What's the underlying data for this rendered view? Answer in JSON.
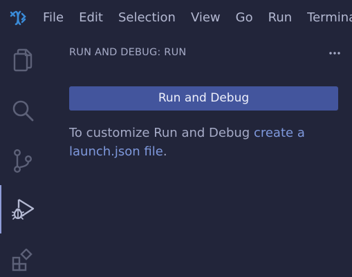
{
  "menubar": {
    "logo_icon": "app-logo-icon",
    "items": [
      "File",
      "Edit",
      "Selection",
      "View",
      "Go",
      "Run",
      "Terminal"
    ]
  },
  "activitybar": {
    "items": [
      {
        "name": "explorer",
        "icon": "files-icon",
        "active": false
      },
      {
        "name": "search",
        "icon": "search-icon",
        "active": false
      },
      {
        "name": "source-control",
        "icon": "source-control-icon",
        "active": false
      },
      {
        "name": "run-and-debug",
        "icon": "run-debug-icon",
        "active": true
      },
      {
        "name": "extensions",
        "icon": "extensions-icon",
        "active": false
      }
    ]
  },
  "sidebar": {
    "title": "RUN AND DEBUG: RUN",
    "more_actions_icon": "ellipsis-icon",
    "run_button_label": "Run and Debug",
    "help_prefix": "To customize Run and Debug ",
    "help_link": "create a launch.json file",
    "help_suffix": "."
  },
  "colors": {
    "background": "#22253a",
    "button": "#43559d",
    "link": "#7f99dd",
    "text": "#a6abc7",
    "icon": "#5d6178"
  }
}
